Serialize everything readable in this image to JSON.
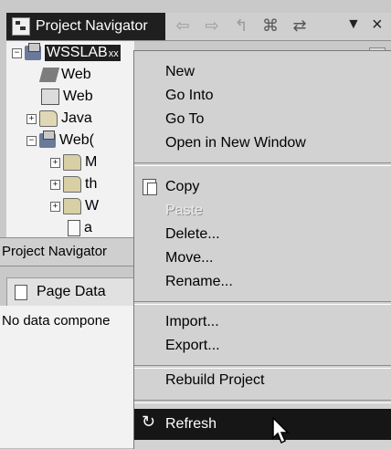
{
  "view": {
    "title": "Project Navigator",
    "toolbar_icons": [
      "back-icon",
      "forward-icon",
      "up-icon",
      "collapse-all-icon",
      "link-with-editor-icon",
      "view-menu-icon",
      "close-icon"
    ]
  },
  "tree": [
    {
      "label": "WSSLAB",
      "suffix": "xx",
      "expander": "−",
      "icon": "project-icon",
      "selected": true
    },
    {
      "label": "Web",
      "icon": "web-deployment-icon"
    },
    {
      "label": "Web",
      "icon": "web-content-icon"
    },
    {
      "label": "Java",
      "expander": "+",
      "icon": "java-resources-icon"
    },
    {
      "label": "Web(",
      "expander": "−",
      "icon": "web-content-folder-icon"
    },
    {
      "label": "M",
      "expander": "+",
      "icon": "folder-icon"
    },
    {
      "label": "th",
      "expander": "+",
      "icon": "folder-icon"
    },
    {
      "label": "W",
      "expander": "+",
      "icon": "folder-icon"
    },
    {
      "label": "a",
      "icon": "file-icon"
    }
  ],
  "lower_tab_bar": {
    "label": "Project Navigator"
  },
  "page_data": {
    "tab_label": "Page Data",
    "message": "No data compone"
  },
  "context_menu": {
    "groups": [
      [
        "New",
        "Go Into",
        "Go To",
        "Open in New Window"
      ],
      [
        "Copy",
        "Paste",
        "Delete...",
        "Move...",
        "Rename..."
      ],
      [
        "Import...",
        "Export..."
      ],
      [
        "Rebuild Project"
      ],
      [
        "Refresh"
      ]
    ],
    "disabled": [
      "Paste"
    ],
    "highlighted": "Refresh",
    "icons": {
      "Copy": "copy-icon",
      "Refresh": "refresh-icon"
    }
  },
  "colors": {
    "selection": "#1f1f1f",
    "menu_bg": "#d2d2d2",
    "tree_bg": "#f2f2f2"
  }
}
